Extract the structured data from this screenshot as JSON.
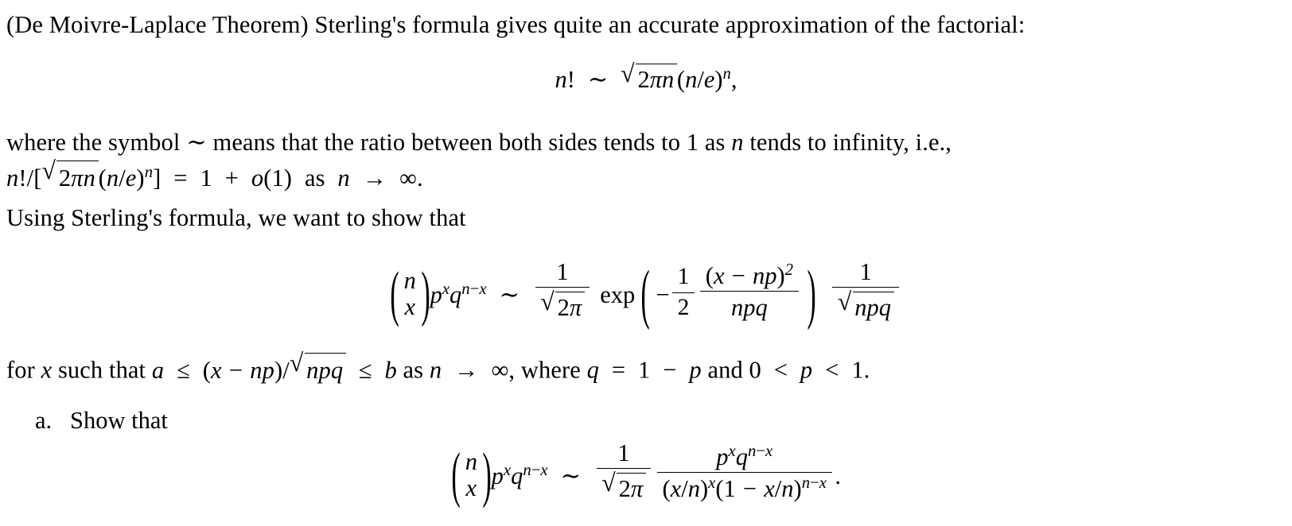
{
  "document": {
    "type": "mathematics-problem",
    "intro": {
      "theorem_name": "(De Moivre-Laplace Theorem)",
      "text": "Sterling's formula gives quite an accurate approximation of the factorial:"
    },
    "equation_stirling": {
      "lhs_n": "n",
      "factorial": "!",
      "tilde": "∼",
      "radical": "√",
      "radicand_2": "2",
      "radicand_pi": "π",
      "radicand_n": "n",
      "paren_open": "(",
      "base_n": "n",
      "slash": "/",
      "base_e": "e",
      "paren_close": ")",
      "exponent_n": "n",
      "comma": ","
    },
    "where_paragraph": {
      "line1_a": "where the symbol ",
      "tilde": "∼",
      "line1_b": " means that the ratio between both sides tends to 1 as ",
      "var_n": "n",
      "line1_c": " tends to infinity, i.e.,",
      "line2": {
        "n": "n",
        "factorial_slash": "!/",
        "bracket_open": "[",
        "radical": "√",
        "radicand": "2πn",
        "rad_2": "2",
        "rad_pi": "π",
        "rad_n": "n",
        "paren_open": "(",
        "n2": "n",
        "slash": "/",
        "e": "e",
        "paren_close": ")",
        "exp_n": "n",
        "bracket_close": "]",
        "equals": "=",
        "one": "1",
        "plus": "+",
        "little_o": "o",
        "o_paren": "(1)",
        "as_text": "as",
        "n3": "n",
        "arrow": "→",
        "infinity": "∞",
        "period": "."
      }
    },
    "using_line": "Using Sterling's formula, we want to show that",
    "equation_main": {
      "binom_top": "n",
      "binom_bottom": "x",
      "p": "p",
      "p_exp": "x",
      "q": "q",
      "q_exp_n": "n",
      "q_exp_minus": "−",
      "q_exp_x": "x",
      "tilde": "∼",
      "frac1_num": "1",
      "frac1_den_radical": "√",
      "frac1_den_2": "2",
      "frac1_den_pi": "π",
      "exp_name": "exp",
      "paren_open": "(",
      "minus": "−",
      "half_num": "1",
      "half_den": "2",
      "bigfrac_num_paren_open": "(",
      "bigfrac_num_x": "x",
      "bigfrac_num_minus": "−",
      "bigfrac_num_np": "np",
      "bigfrac_num_paren_close": ")",
      "bigfrac_num_sq": "2",
      "bigfrac_den": "npq",
      "paren_close": ")",
      "frac2_num": "1",
      "frac2_den_radical": "√",
      "frac2_den_npq": "npq"
    },
    "for_x_line": {
      "a": "for ",
      "x": "x",
      "b": " such that ",
      "var_a": "a",
      "le1": "≤",
      "paren_open": "(",
      "x2": "x",
      "minus": "−",
      "np": "np",
      "paren_close": ")",
      "slash": "/",
      "radical": "√",
      "npq": "npq",
      "le2": "≤",
      "var_b": "b",
      "as_text": " as ",
      "n": "n",
      "arrow": "→",
      "infinity": "∞",
      "comma_where": ", where ",
      "q": "q",
      "equals": "=",
      "one": "1",
      "minus2": "−",
      "p": "p",
      "and_text": " and ",
      "zero": "0",
      "lt1": "<",
      "p2": "p",
      "lt2": "<",
      "one2": "1",
      "period": "."
    },
    "items": [
      {
        "label": "a.",
        "text": "Show that",
        "equation": {
          "binom_top": "n",
          "binom_bottom": "x",
          "p": "p",
          "p_exp": "x",
          "q": "q",
          "q_exp_n": "n",
          "q_exp_minus": "−",
          "q_exp_x": "x",
          "tilde": "∼",
          "frac1_num": "1",
          "frac1_den_radical": "√",
          "frac1_den_2": "2",
          "frac1_den_pi": "π",
          "frac2_num_p": "p",
          "frac2_num_p_exp": "x",
          "frac2_num_q": "q",
          "frac2_num_q_exp_n": "n",
          "frac2_num_q_exp_minus": "−",
          "frac2_num_q_exp_x": "x",
          "frac2_den_paren_open": "(",
          "frac2_den_x": "x",
          "frac2_den_slash": "/",
          "frac2_den_n": "n",
          "frac2_den_paren_close": ")",
          "frac2_den_exp_x": "x",
          "frac2_den_paren_open2": "(",
          "frac2_den_one": "1",
          "frac2_den_minus": "−",
          "frac2_den_x2": "x",
          "frac2_den_slash2": "/",
          "frac2_den_n2": "n",
          "frac2_den_paren_close2": ")",
          "frac2_den_exp_n": "n",
          "frac2_den_exp_minus": "−",
          "frac2_den_exp_x2": "x",
          "period": "."
        }
      }
    ]
  },
  "colors": {
    "text": "#000000",
    "background": "#ffffff"
  }
}
